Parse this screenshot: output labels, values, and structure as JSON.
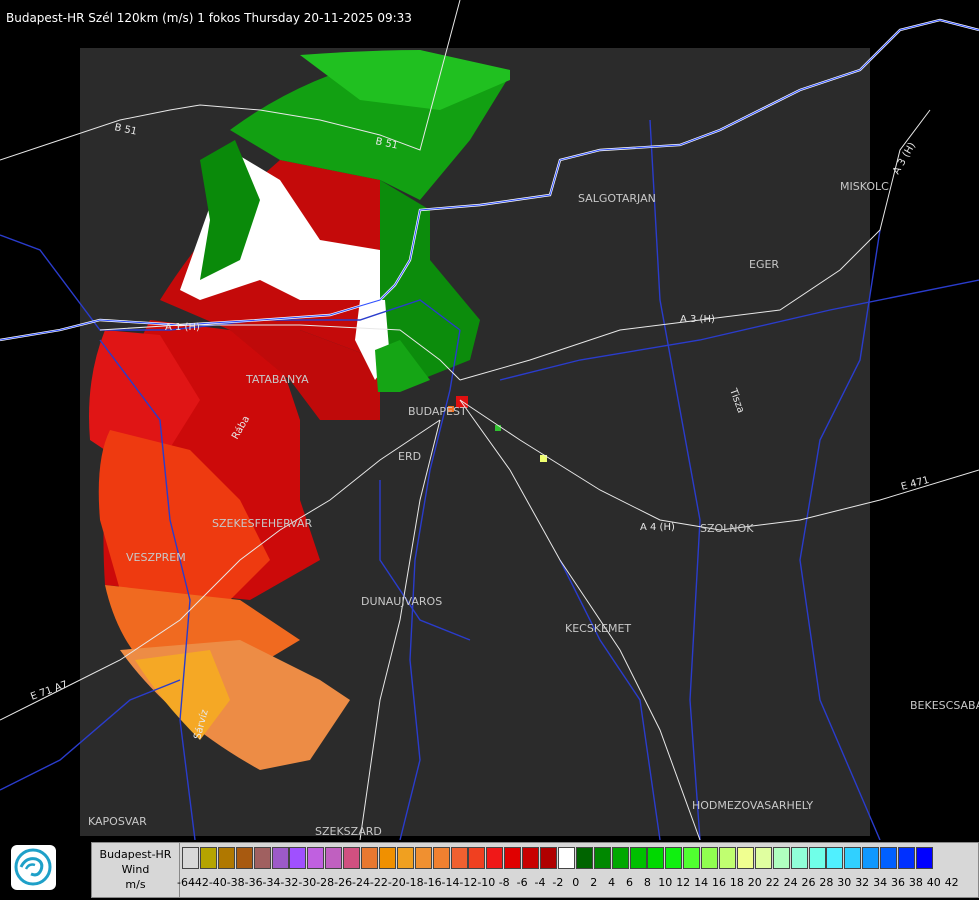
{
  "header": {
    "title": "Budapest-HR Szél 120km (m/s) 1 fokos Thursday 20-11-2025 09:33"
  },
  "map": {
    "cities": [
      "SALGOTARJAN",
      "EGER",
      "MISKOLC",
      "TATABANYA",
      "BUDAPEST",
      "ERD",
      "SZEKESFEHERVAR",
      "VESZPREM",
      "DUNAUJVAROS",
      "KECSKEMET",
      "SZOLNOK",
      "BEKESCSABA",
      "HODMEZOVASARHELY",
      "KAPOSVAR",
      "SZEKSZARD"
    ],
    "roads": [
      "B 51",
      "B 51",
      "A 3 (H)",
      "A 3 (H)",
      "A 1 (H)",
      "A 4 (H)",
      "E 471",
      "E 71 A7"
    ],
    "rivers": [
      "Rába",
      "Sárvíz",
      "Tisza"
    ]
  },
  "legend": {
    "line1": "Budapest-HR",
    "line2": "Wind",
    "line3": "m/s",
    "ticks": [
      "-64",
      "-42",
      "-40",
      "-38",
      "-36",
      "-34",
      "-32",
      "-30",
      "-28",
      "-26",
      "-24",
      "-22",
      "-20",
      "-18",
      "-16",
      "-14",
      "-12",
      "-10",
      "-8",
      "-6",
      "-4",
      "-2",
      "0",
      "2",
      "4",
      "6",
      "8",
      "10",
      "12",
      "14",
      "16",
      "18",
      "20",
      "22",
      "24",
      "26",
      "28",
      "30",
      "32",
      "34",
      "36",
      "38",
      "40",
      "42"
    ],
    "colors": [
      "#d8d8d8",
      "#b5a400",
      "#b07800",
      "#a85a10",
      "#a06060",
      "#9c5ac8",
      "#a050ff",
      "#c060e0",
      "#c060c0",
      "#d05080",
      "#e87830",
      "#f09000",
      "#f0a020",
      "#f09030",
      "#f08030",
      "#f06030",
      "#f04020",
      "#f01818",
      "#e00000",
      "#c80000",
      "#b00000",
      "#ffffff",
      "#006400",
      "#008800",
      "#00a800",
      "#00c000",
      "#00d800",
      "#10f010",
      "#50ff30",
      "#90ff50",
      "#c0ff70",
      "#f0ff90",
      "#e0ffa0",
      "#b0ffc0",
      "#90ffd8",
      "#70ffe8",
      "#50f0ff",
      "#30d0ff",
      "#1098ff",
      "#0060ff",
      "#0030ff",
      "#0000ff"
    ]
  }
}
